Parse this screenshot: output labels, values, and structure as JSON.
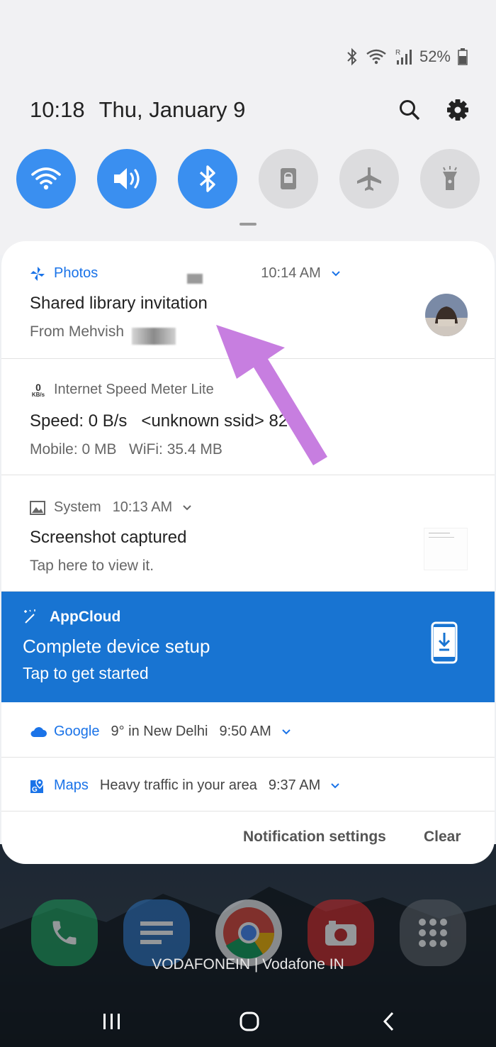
{
  "status_bar": {
    "battery_text": "52%",
    "icons": [
      "bluetooth-icon",
      "wifi-icon",
      "signal-icon",
      "battery-icon"
    ]
  },
  "header": {
    "time": "10:18",
    "date": "Thu, January 9",
    "icons": [
      "search-icon",
      "settings-icon"
    ]
  },
  "quick_toggles": [
    {
      "name": "wifi",
      "state": "on"
    },
    {
      "name": "sound",
      "state": "on"
    },
    {
      "name": "bluetooth",
      "state": "on"
    },
    {
      "name": "screen-lock",
      "state": "off"
    },
    {
      "name": "airplane-mode",
      "state": "off"
    },
    {
      "name": "flashlight",
      "state": "off"
    }
  ],
  "notifications": {
    "photos": {
      "app": "Photos",
      "time": "10:14 AM",
      "title": "Shared library invitation",
      "subtitle": "From Mehvish"
    },
    "speed_meter": {
      "icon_value": "0",
      "icon_unit": "KB/s",
      "app": "Internet Speed Meter Lite",
      "title": "Speed: 0 B/s   <unknown ssid> 82%",
      "subtitle": "Mobile: 0 MB   WiFi: 35.4 MB"
    },
    "system": {
      "app": "System",
      "time": "10:13 AM",
      "title": "Screenshot captured",
      "subtitle": "Tap here to view it."
    },
    "appcloud": {
      "app": "AppCloud",
      "title": "Complete device setup",
      "subtitle": "Tap to get started"
    },
    "google": {
      "app": "Google",
      "summary": "9° in New Delhi",
      "time": "9:50 AM"
    },
    "maps": {
      "app": "Maps",
      "summary": "Heavy traffic in your area",
      "time": "9:37 AM"
    }
  },
  "footer": {
    "settings_label": "Notification settings",
    "clear_label": "Clear"
  },
  "carrier": "VODAFONEIN | Vodafone IN",
  "colors": {
    "toggle_on": "#3a8ff0",
    "appcloud_bg": "#1874d2",
    "accent_blue": "#1a73e8",
    "arrow": "#c77ee0"
  }
}
